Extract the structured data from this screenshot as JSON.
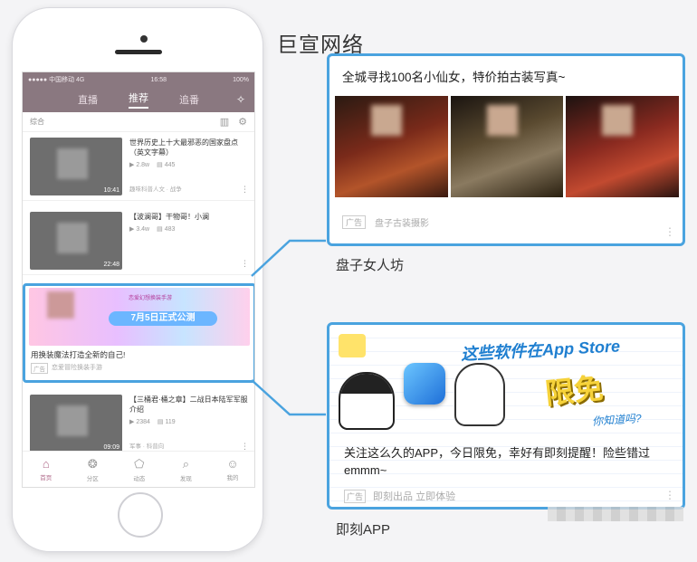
{
  "brand": "巨宣网络",
  "phone": {
    "status": {
      "carrier": "●●●●● 中国移动 4G",
      "time": "16:58",
      "battery": "100%"
    },
    "tabs": [
      {
        "label": "直播"
      },
      {
        "label": "推荐",
        "active": true
      },
      {
        "label": "追番"
      }
    ],
    "sub_bar": {
      "label": "综合"
    },
    "feed": [
      {
        "title": "世界历史上十大最邪恶的国家盘点（英文字幕）",
        "plays": "2.8w",
        "comments": "445",
        "source": "趣味科普人文 · 战争",
        "duration": "10:41"
      },
      {
        "title": "【波澜哥】干物哥！小澜",
        "plays": "3.4w",
        "comments": "483",
        "source": "",
        "duration": "22:48"
      },
      {
        "title": "【三桶君·桶之章】二战日本陆军军服介绍",
        "plays": "2384",
        "comments": "119",
        "source": "军事 · 科普向",
        "duration": "09:09"
      }
    ],
    "ad": {
      "banner_small": "恋爱幻想换装手游",
      "banner_launch": "7月5日正式公测",
      "text": "用换装魔法打造全新的自己!",
      "tag": "广告",
      "source": "恋爱冒险换装手游"
    },
    "bottom_nav": [
      {
        "label": "首页",
        "icon": "home-icon",
        "glyph": "⌂",
        "active": true
      },
      {
        "label": "分区",
        "icon": "category-icon",
        "glyph": "❂"
      },
      {
        "label": "动态",
        "icon": "dynamic-icon",
        "glyph": "⬠"
      },
      {
        "label": "发现",
        "icon": "search-icon",
        "glyph": "⌕"
      },
      {
        "label": "我的",
        "icon": "profile-icon",
        "glyph": "☺"
      }
    ]
  },
  "card1": {
    "title": "全城寻找100名小仙女，特价拍古装写真~",
    "tag": "广告",
    "source": "盘子古装摄影",
    "label": "盘子女人坊"
  },
  "card2": {
    "headline": "这些软件在App Store",
    "limit": "限免",
    "know": "你知道吗?",
    "text": "关注这么久的APP，今日限免，幸好有即刻提醒！险些错过emmm~",
    "tag": "广告",
    "source": "即刻出品 立即体验",
    "label": "即刻APP"
  },
  "colors": {
    "accent_border": "#4aa3df",
    "header_bg": "#8a7880"
  }
}
